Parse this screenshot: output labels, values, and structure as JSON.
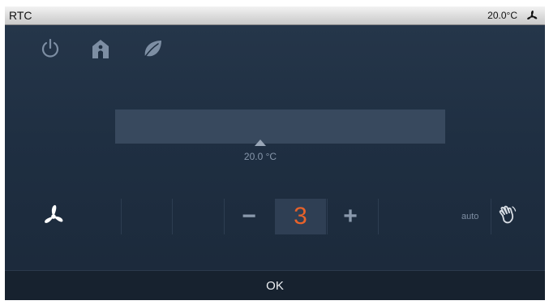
{
  "titlebar": {
    "title": "RTC",
    "temperature": "20.0°C",
    "status_icon": "fan-icon"
  },
  "modes": [
    {
      "name": "power-icon"
    },
    {
      "name": "presence-icon"
    },
    {
      "name": "eco-leaf-icon"
    }
  ],
  "setpoint": {
    "label": "20.0 °C"
  },
  "fan_control": {
    "icon": "fan-icon",
    "decrease_label": "−",
    "speed": "3",
    "increase_label": "+",
    "auto_label": "auto",
    "manual_icon": "hand-icon"
  },
  "footer": {
    "ok_label": "OK"
  },
  "colors": {
    "background": "#1f2f42",
    "speed_value": "#e8622a",
    "icon_muted": "#7d8ea3"
  }
}
